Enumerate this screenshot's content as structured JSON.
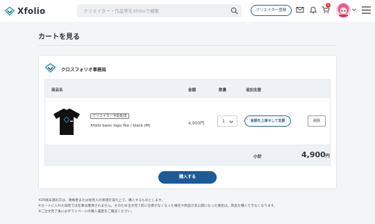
{
  "header": {
    "brand": "Xfolio",
    "search_placeholder": "クリエイター・作品等をXfolioで検索",
    "creator_register_label": "クリエイター登録",
    "cart_count": "1",
    "icons": [
      "mail-icon",
      "bell-icon",
      "cart-icon",
      "chevron-down-icon",
      "menu-icon",
      "search-icon"
    ]
  },
  "page": {
    "title": "カートを見る"
  },
  "cart": {
    "shop_name": "クロスフォリオ事務局",
    "columns": {
      "product": "商品名",
      "price": "金額",
      "quantity": "数量",
      "support": "追加支援"
    },
    "items": [
      {
        "tag": "クリエイター手配配送",
        "name": "Xfolio basic logo Tee / black (M)",
        "price": "4,900円",
        "quantity": "1",
        "support_label": "金額を上乗せして支援",
        "delete_label": "削除"
      }
    ],
    "subtotal_label": "小計",
    "subtotal_value": "4,900",
    "subtotal_unit": "円",
    "buy_label": "購入する"
  },
  "notes": [
    "※20歳未満の方は、親権者または後見人の承諾を得た上で、購入するものとします。",
    "※カートに入れた段階では在庫は確保されません。そのため注文完了前に在庫がなくなった場合や商品が非公開になった場合は、商品を購入できなくなります。",
    "※ご注文完了後に必ずマイページの購入履歴をご確認ください。"
  ],
  "colors": {
    "brand_navy": "#1d5a98",
    "accent_blue": "#2a5d96",
    "badge_red": "#e53935",
    "logo_teal": "#3aa6c4"
  }
}
